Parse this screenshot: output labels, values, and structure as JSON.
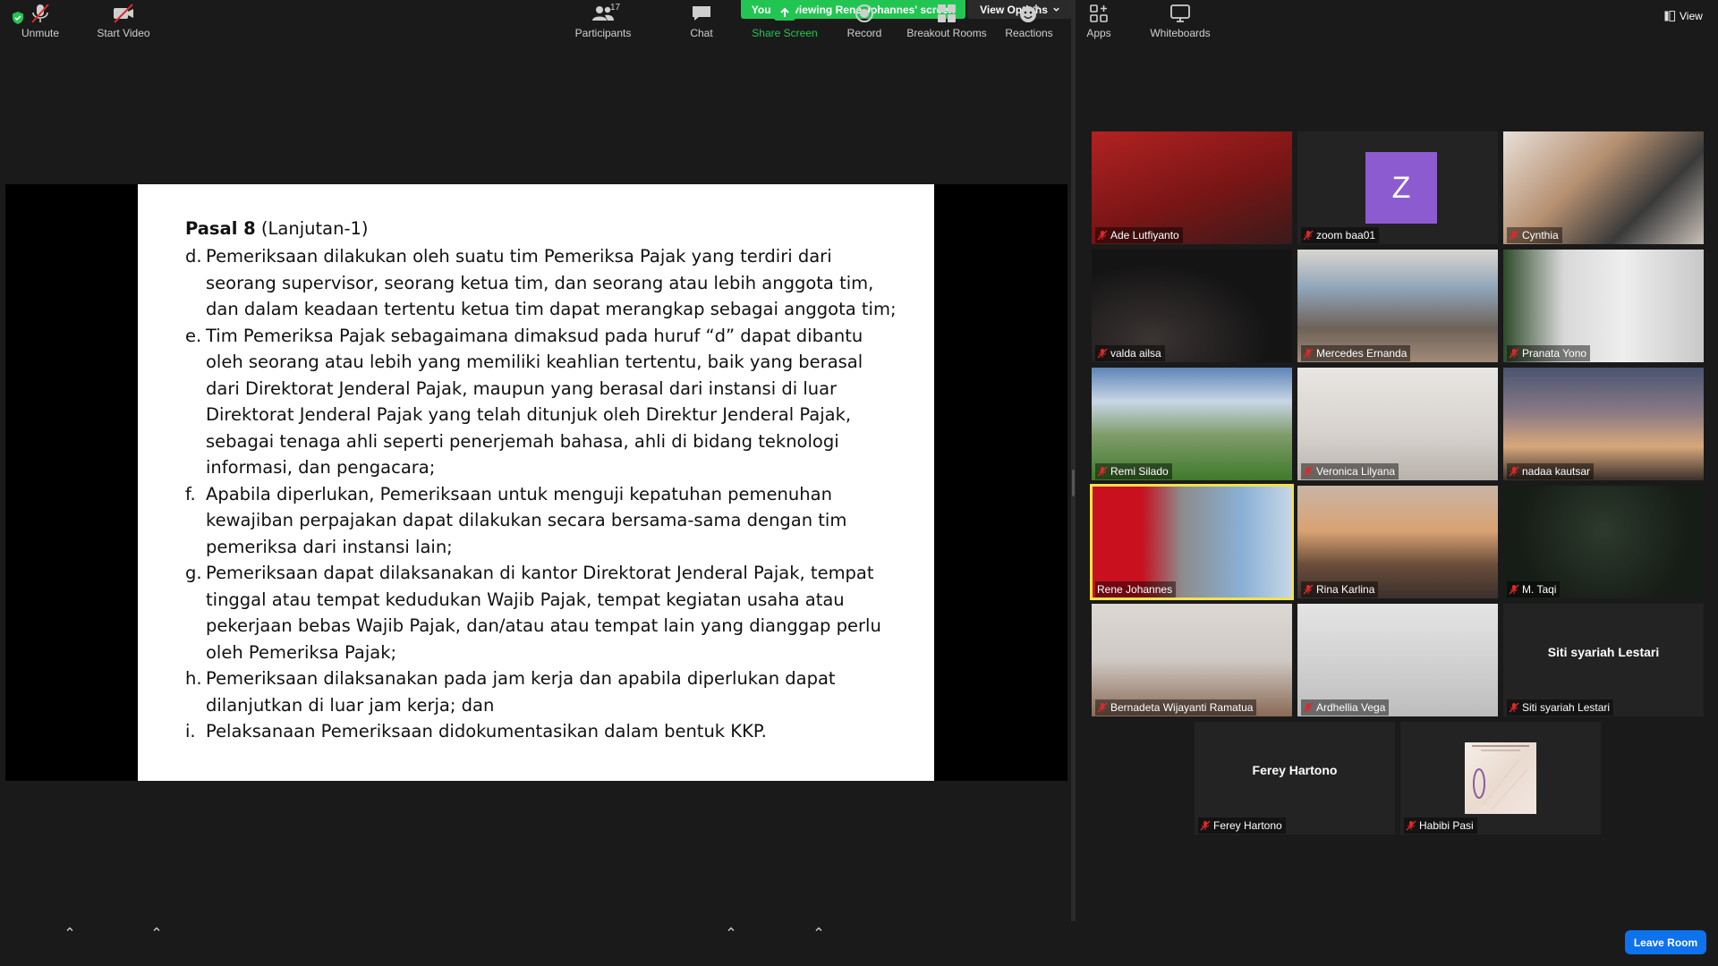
{
  "top": {
    "banner": "You are viewing Rene Johannes' screen",
    "view_options": "View Options",
    "view": "View"
  },
  "slide": {
    "title_bold": "Pasal 8",
    "title_rest": " (Lanjutan-1)",
    "items": [
      {
        "letter": "d.",
        "text": "Pemeriksaan dilakukan oleh suatu tim Pemeriksa Pajak yang terdiri dari seorang supervisor, seorang ketua tim, dan seorang atau lebih anggota tim, dan dalam keadaan tertentu ketua tim dapat merangkap sebagai anggota tim;"
      },
      {
        "letter": "e.",
        "text": "Tim Pemeriksa Pajak sebagaimana dimaksud pada huruf “d” dapat dibantu oleh seorang atau lebih yang memiliki keahlian tertentu, baik yang berasal dari Direktorat Jenderal Pajak, maupun yang berasal dari instansi di luar Direktorat Jenderal Pajak yang telah ditunjuk oleh Direktur Jenderal Pajak, sebagai tenaga ahli seperti penerjemah bahasa, ahli di bidang teknologi informasi, dan pengacara;"
      },
      {
        "letter": "f.",
        "text": "Apabila diperlukan, Pemeriksaan untuk menguji kepatuhan pemenuhan kewajiban perpajakan dapat dilakukan secara bersama-sama dengan tim pemeriksa dari instansi lain;"
      },
      {
        "letter": "g.",
        "text": "Pemeriksaan dapat dilaksanakan di kantor Direktorat Jenderal Pajak, tempat tinggal atau tempat kedudukan Wajib Pajak, tempat kegiatan usaha atau pekerjaan bebas Wajib Pajak, dan/atau atau tempat lain yang dianggap perlu oleh Pemeriksa Pajak;"
      },
      {
        "letter": "h.",
        "text": "Pemeriksaan dilaksanakan pada jam kerja dan apabila diperlukan dapat dilanjutkan di luar jam kerja; dan"
      },
      {
        "letter": "i.",
        "text": "Pelaksanaan Pemeriksaan didokumentasikan dalam bentuk KKP."
      }
    ]
  },
  "participants": [
    {
      "name": "Ade Lutfiyanto"
    },
    {
      "name": "zoom baa01",
      "avatar": "Z"
    },
    {
      "name": "Cynthia"
    },
    {
      "name": "valda ailsa"
    },
    {
      "name": "Mercedes Ernanda"
    },
    {
      "name": "Pranata Yono"
    },
    {
      "name": "Remi Silado"
    },
    {
      "name": "Veronica Lilyana"
    },
    {
      "name": "nadaa kautsar"
    },
    {
      "name": "Rene Johannes"
    },
    {
      "name": "Rina Karlina"
    },
    {
      "name": "M. Taqi"
    },
    {
      "name": "Bernadeta Wijayanti Ramatua"
    },
    {
      "name": "Ardhellia Vega"
    },
    {
      "name": "Siti syariah Lestari",
      "label": "Siti syariah Lestari"
    },
    {
      "name": "Ferey Hartono",
      "label": "Ferey Hartono"
    },
    {
      "name": "Habibi Pasi"
    }
  ],
  "toolbar": {
    "unmute": "Unmute",
    "start_video": "Start Video",
    "participants": "Participants",
    "participants_count": "17",
    "chat": "Chat",
    "share_screen": "Share Screen",
    "record": "Record",
    "breakout_rooms": "Breakout Rooms",
    "reactions": "Reactions",
    "apps": "Apps",
    "whiteboards": "Whiteboards",
    "leave": "Leave Room"
  },
  "colors": {
    "share_green": "#23c552",
    "leave_blue": "#0e72ed",
    "active_speaker": "#f2e24a",
    "muted_red": "#e02828"
  }
}
